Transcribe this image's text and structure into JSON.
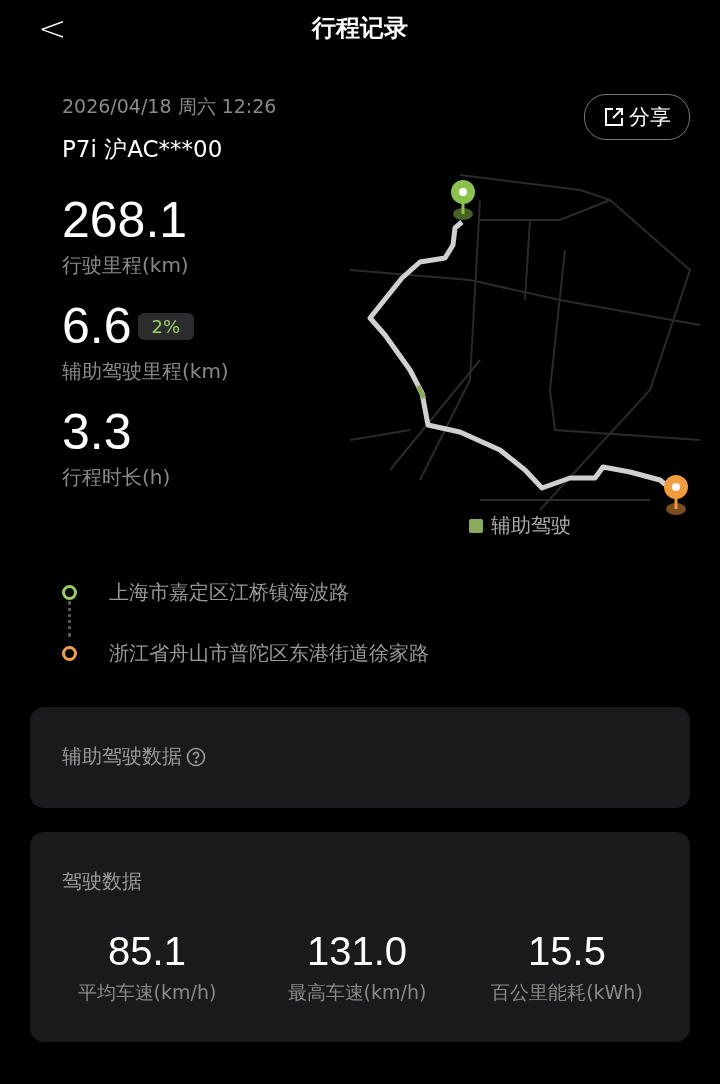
{
  "header": {
    "back": "<",
    "title": "行程记录"
  },
  "trip": {
    "datetime": "2026/04/18 周六 12:26",
    "vehicle": "P7i 沪AC***00",
    "share": "分享"
  },
  "stats": [
    {
      "value": "268.1",
      "label": "行驶里程(km)"
    },
    {
      "value": "6.6",
      "badge": "2%",
      "label": "辅助驾驶里程(km)"
    },
    {
      "value": "3.3",
      "label": "行程时长(h)"
    }
  ],
  "map": {
    "legend": "辅助驾驶"
  },
  "waypoints": [
    {
      "address": "上海市嘉定区江桥镇海波路",
      "color": "#9ccc65"
    },
    {
      "address": "浙江省舟山市普陀区东港街道徐家路",
      "color": "#f0a04b"
    }
  ],
  "assist_card": {
    "title": "辅助驾驶数据"
  },
  "driving_card": {
    "title": "驾驶数据",
    "metrics": [
      {
        "value": "85.1",
        "label": "平均车速(km/h)"
      },
      {
        "value": "131.0",
        "label": "最高车速(km/h)"
      },
      {
        "value": "15.5",
        "label": "百公里能耗(kWh)"
      }
    ]
  }
}
